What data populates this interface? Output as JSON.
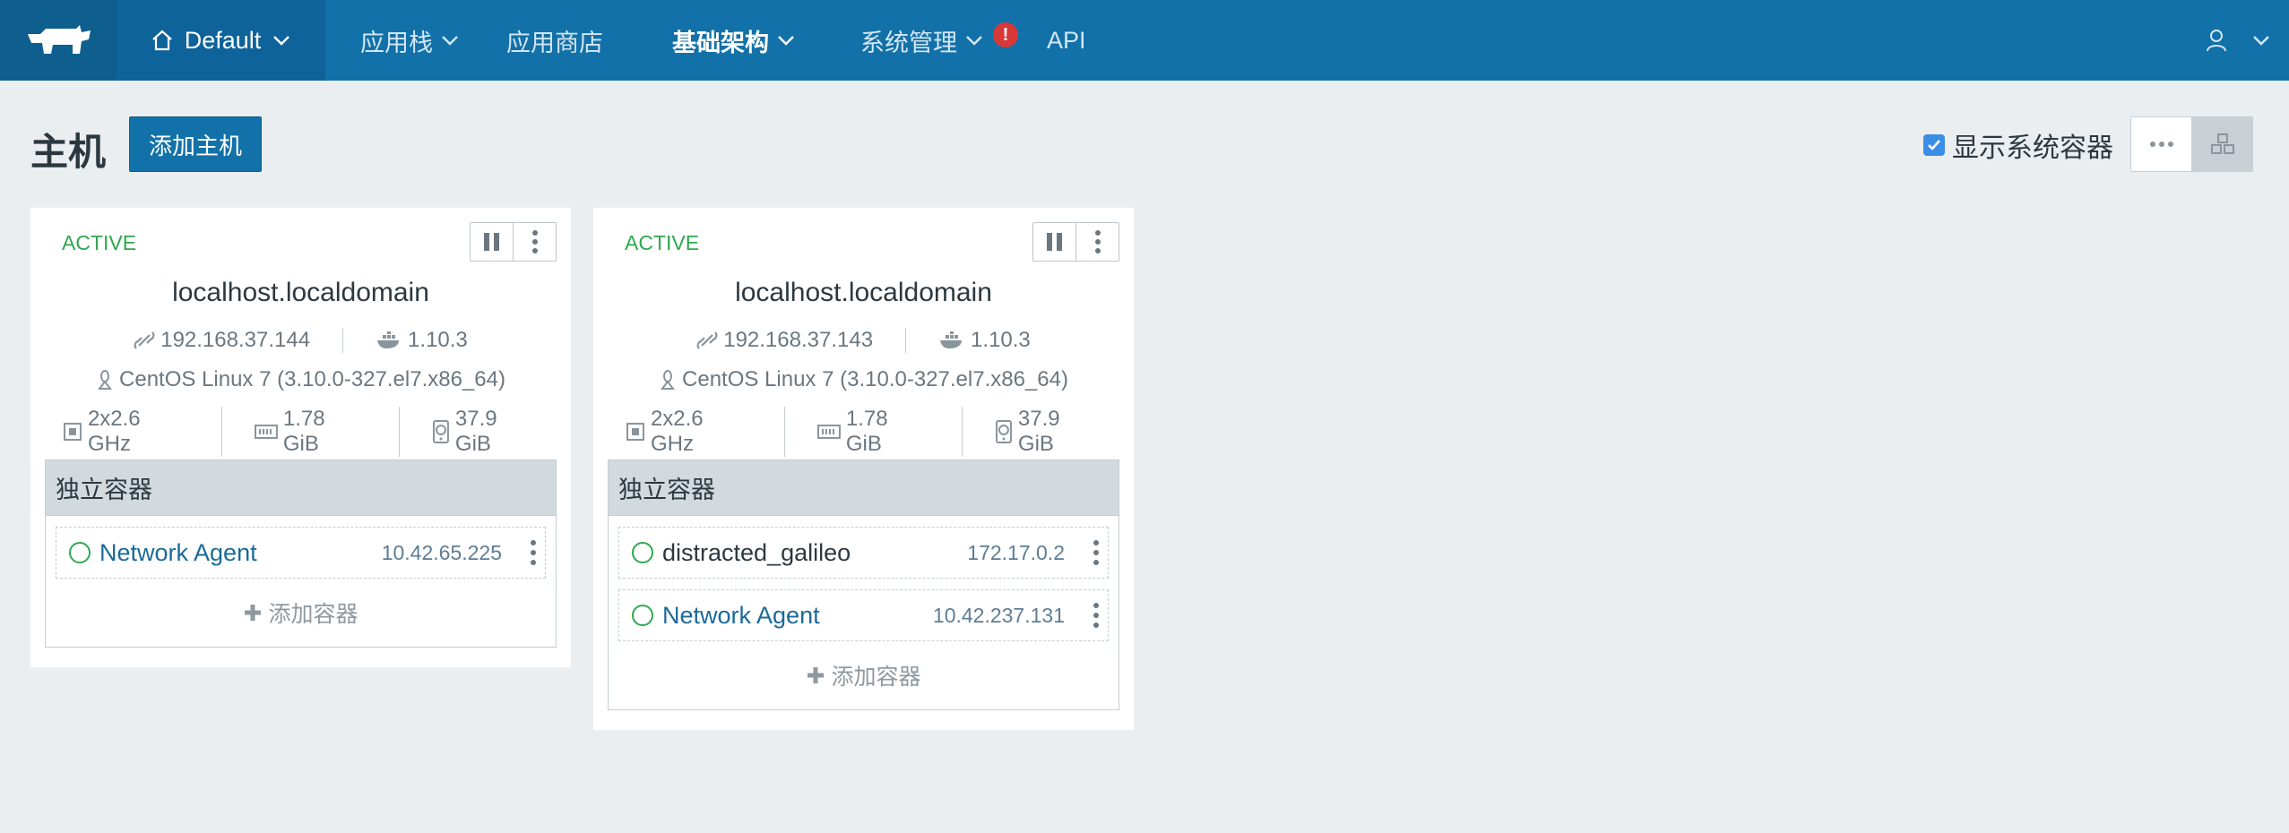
{
  "nav": {
    "environment": "Default",
    "items": [
      {
        "label": "应用栈",
        "has_dropdown": true
      },
      {
        "label": "应用商店",
        "has_dropdown": false
      },
      {
        "label": "基础架构",
        "has_dropdown": true,
        "active": true
      },
      {
        "label": "系统管理",
        "has_dropdown": true,
        "alert": "!"
      },
      {
        "label": "API",
        "has_dropdown": false
      }
    ]
  },
  "header": {
    "title": "主机",
    "add_button": "添加主机",
    "show_system_label": "显示系统容器",
    "show_system_checked": true
  },
  "hosts": [
    {
      "state": "ACTIVE",
      "hostname": "localhost.localdomain",
      "ip": "192.168.37.144",
      "docker_version": "1.10.3",
      "os": "CentOS Linux 7 (3.10.0-327.el7.x86_64)",
      "cpu": "2x2.6 GHz",
      "memory": "1.78 GiB",
      "storage": "37.9 GiB",
      "section_title": "独立容器",
      "containers": [
        {
          "name": "Network Agent",
          "ip": "10.42.65.225"
        }
      ],
      "add_container": "添加容器"
    },
    {
      "state": "ACTIVE",
      "hostname": "localhost.localdomain",
      "ip": "192.168.37.143",
      "docker_version": "1.10.3",
      "os": "CentOS Linux 7 (3.10.0-327.el7.x86_64)",
      "cpu": "2x2.6 GHz",
      "memory": "1.78 GiB",
      "storage": "37.9 GiB",
      "section_title": "独立容器",
      "containers": [
        {
          "name": "distracted_galileo",
          "ip": "172.17.0.2"
        },
        {
          "name": "Network Agent",
          "ip": "10.42.237.131"
        }
      ],
      "add_container": "添加容器"
    }
  ],
  "colors": {
    "nav_bg": "#1271a8",
    "active_state": "#2fa84f",
    "primary": "#1271a8",
    "page_bg": "#ebeef0"
  }
}
